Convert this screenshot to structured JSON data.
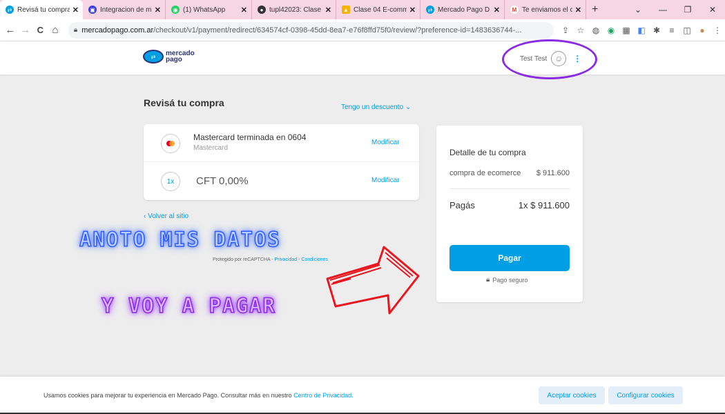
{
  "browser": {
    "tabs": [
      {
        "label": "Revisá tu compra",
        "icon": "mercadopago-icon",
        "color": "#009ee3",
        "active": true
      },
      {
        "label": "Integracion de m",
        "icon": "integration-icon",
        "color": "#3b3fd8"
      },
      {
        "label": "(1) WhatsApp",
        "icon": "whatsapp-icon",
        "color": "#25d366"
      },
      {
        "label": "tupl42023: Clase",
        "icon": "github-icon",
        "color": "#333333"
      },
      {
        "label": "Clase 04 E-comm",
        "icon": "drive-icon",
        "color": "#f4b400"
      },
      {
        "label": "Mercado Pago D",
        "icon": "mercadopago-icon",
        "color": "#009ee3"
      },
      {
        "label": "Te enviamos el c",
        "icon": "gmail-icon",
        "color": "#ea4335"
      }
    ],
    "new_tab": "+",
    "window_buttons": [
      "⌄",
      "—",
      "❐",
      "✕"
    ],
    "nav": {
      "back": "←",
      "forward": "→",
      "reload": "C",
      "home": "⌂"
    },
    "url_domain": "mercadopago.com.ar",
    "url_path": "/checkout/v1/payment/redirect/634574cf-0398-45dd-8ea7-e76f8ffd75f0/review/?preference-id=1483636744-..."
  },
  "header": {
    "logo_line1": "mercado",
    "logo_line2": "pago",
    "user_name": "Test Test",
    "menu_glyph": "⋮"
  },
  "review": {
    "title": "Revisá tu compra",
    "discount_link": "Tengo un descuento ⌄",
    "card_title": "Mastercard terminada en 0604",
    "card_subtitle": "Mastercard",
    "installments_icon": "1x",
    "cft": "CFT 0,00%",
    "modify_label": "Modificar",
    "back_link": "‹  Volver al sitio",
    "recaptcha_prefix": "Protegido por reCAPTCHA - ",
    "recaptcha_privacy": "Privacidad",
    "recaptcha_sep": " - ",
    "recaptcha_terms": "Condiciones"
  },
  "summary": {
    "heading": "Detalle de tu compra",
    "item_label": "compra de ecomerce",
    "item_amount": "$ 911.600",
    "pay_label": "Pagás",
    "pay_amount": "1x $ 911.600",
    "pay_button": "Pagar",
    "secure_label": "Pago seguro"
  },
  "annotations": {
    "line1": "ANOTO MIS DATOS",
    "line2": "Y VOY A PAGAR",
    "circle_color": "#8a2be2",
    "arrow_color": "#e8161e"
  },
  "cookies": {
    "text": "Usamos cookies para mejorar tu experiencia en Mercado Pago. Consultar más en nuestro ",
    "link": "Centro de Privacidad.",
    "accept": "Aceptar cookies",
    "configure": "Configurar cookies"
  },
  "colors": {
    "accent": "#009ee3",
    "background": "#ededed",
    "tabbar": "#f7d6e4"
  }
}
